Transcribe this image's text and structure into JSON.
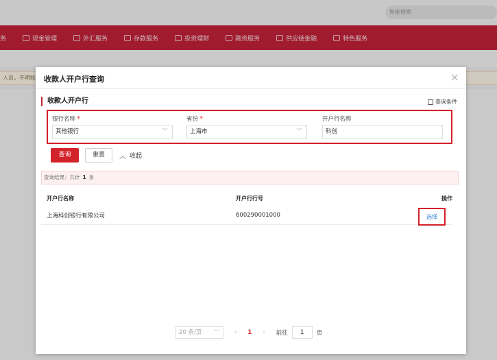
{
  "background": {
    "search_placeholder": "智能搜索",
    "nav_items": [
      {
        "label": "务",
        "icon": "menu-icon"
      },
      {
        "label": "现金管理",
        "icon": "cash-icon"
      },
      {
        "label": "外汇服务",
        "icon": "forex-icon"
      },
      {
        "label": "存款服务",
        "icon": "deposit-icon"
      },
      {
        "label": "投资理财",
        "icon": "invest-icon"
      },
      {
        "label": "融资服务",
        "icon": "finance-icon"
      },
      {
        "label": "供应链金融",
        "icon": "supply-chain-icon"
      },
      {
        "label": "特色服务",
        "icon": "feature-icon"
      }
    ],
    "notice": "人员，不明账户"
  },
  "modal": {
    "title": "收款人开户行查询",
    "close_icon": "×",
    "section_title": "收款人开户行",
    "query_condition_label": "查询条件",
    "form": {
      "bank_name": {
        "label": "银行名称",
        "value": "其他银行",
        "required": true
      },
      "province": {
        "label": "省份",
        "value": "上海市",
        "required": true
      },
      "branch_name": {
        "label": "开户行名称",
        "value": "科创"
      }
    },
    "buttons": {
      "query": "查询",
      "reset": "重置",
      "collapse": "收起"
    },
    "result": {
      "prefix": "查询结果：共计",
      "count": "1",
      "suffix": "条"
    },
    "table": {
      "headers": [
        "开户行名称",
        "开户行行号",
        "操作"
      ],
      "rows": [
        {
          "name": "上海科创银行有限公司",
          "code": "600290001000",
          "action": "选择"
        }
      ]
    },
    "pagination": {
      "page_size": "20 条/页",
      "current_page": "1",
      "goto_label": "前往",
      "goto_value": "1",
      "page_label": "页"
    }
  },
  "colors": {
    "brand_red": "#c5223a",
    "primary_button": "#d2232a",
    "highlight_border": "#d41f2a",
    "link": "#2f7bd4"
  }
}
